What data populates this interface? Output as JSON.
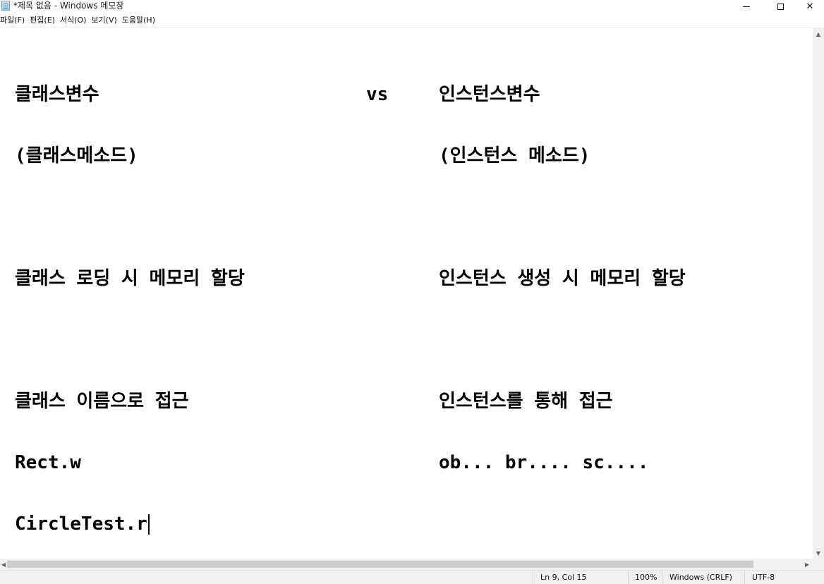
{
  "window": {
    "title": "*제목 없음 - Windows 메모장",
    "minimize_label": "—",
    "close_label": "✕"
  },
  "menu": {
    "items": [
      "파일(F)",
      "편집(E)",
      "서식(O)",
      "보기(V)",
      "도움말(H)"
    ]
  },
  "editor": {
    "lines": [
      {
        "left": "클래스변수",
        "vs": "vs",
        "right": "인스턴스변수"
      },
      {
        "left": "(클래스메소드)",
        "right": "(인스턴스 메소드)"
      },
      {
        "left": "",
        "right": ""
      },
      {
        "left": "클래스 로딩 시 메모리 할당",
        "right": "인스턴스 생성 시 메모리 할당"
      },
      {
        "left": "",
        "right": ""
      },
      {
        "left": "클래스 이름으로 접근",
        "right": "인스턴스를 통해 접근"
      },
      {
        "left": "Rect.w",
        "right": "ob... br.... sc...."
      },
      {
        "left": "CircleTest.r",
        "right": ""
      }
    ]
  },
  "status": {
    "position": "Ln 9, Col 15",
    "zoom": "100%",
    "line_ending": "Windows (CRLF)",
    "encoding": "UTF-8"
  },
  "icons": [
    "notepad-icon",
    "minimize-icon",
    "maximize-icon",
    "close-icon",
    "scroll-up-icon",
    "scroll-down-icon",
    "scroll-left-icon",
    "scroll-right-icon"
  ]
}
